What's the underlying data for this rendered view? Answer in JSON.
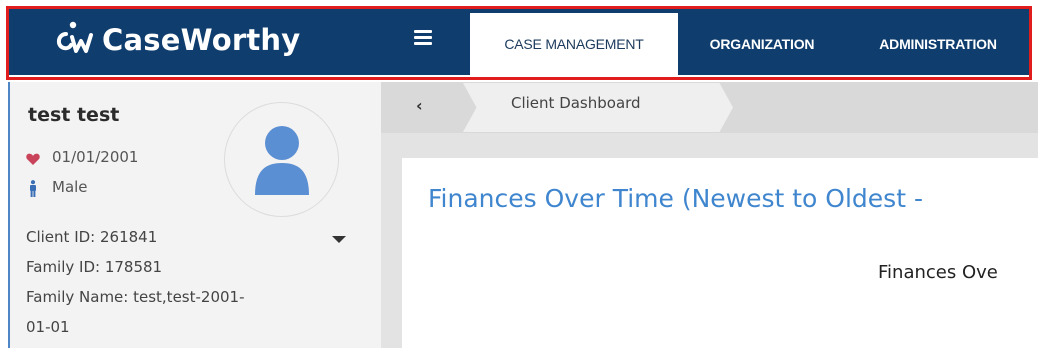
{
  "brand": {
    "name": "CaseWorthy"
  },
  "nav": {
    "tabs": [
      {
        "label": "CASE MANAGEMENT",
        "active": true
      },
      {
        "label": "ORGANIZATION",
        "active": false
      },
      {
        "label": "ADMINISTRATION",
        "active": false
      }
    ]
  },
  "client": {
    "name": "test test",
    "dob": "01/01/2001",
    "gender": "Male",
    "client_id": "Client ID: 261841",
    "family_id": "Family ID: 178581",
    "family_name_line1": "Family Name: test,test-2001-",
    "family_name_line2": "01-01"
  },
  "breadcrumb": {
    "current": "Client Dashboard"
  },
  "main": {
    "section_title": "Finances Over Time (Newest to Oldest -",
    "chart_title": "Finances Ove"
  },
  "colors": {
    "topbar": "#0f3d6e",
    "highlight": "#e01c1c",
    "accent": "#3f86cf",
    "heart": "#c9445b",
    "person": "#3a6fb6"
  }
}
